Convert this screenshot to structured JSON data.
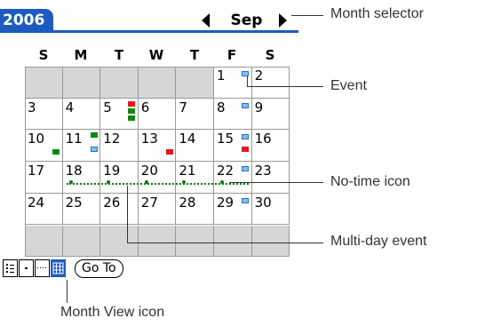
{
  "header": {
    "year": "2006",
    "month": "Sep"
  },
  "weekdays": [
    "S",
    "M",
    "T",
    "W",
    "T",
    "F",
    "S"
  ],
  "days": {
    "d1": "1",
    "d2": "2",
    "d3": "3",
    "d4": "4",
    "d5": "5",
    "d6": "6",
    "d7": "7",
    "d8": "8",
    "d9": "9",
    "d10": "10",
    "d11": "11",
    "d12": "12",
    "d13": "13",
    "d14": "14",
    "d15": "15",
    "d16": "16",
    "d17": "17",
    "d18": "18",
    "d19": "19",
    "d20": "20",
    "d21": "21",
    "d22": "22",
    "d23": "23",
    "d24": "24",
    "d25": "25",
    "d26": "26",
    "d27": "27",
    "d28": "28",
    "d29": "29",
    "d30": "30"
  },
  "toolbar": {
    "goto_label": "Go To"
  },
  "callouts": {
    "month_selector": "Month selector",
    "event": "Event",
    "no_time_icon": "No-time icon",
    "multi_day_event": "Multi-day event",
    "month_view_icon": "Month View icon"
  },
  "colors": {
    "accent": "#1d5bc0",
    "event_blue": "#7ec0ee",
    "event_green": "#0a8a0a",
    "event_red": "#e11b1b",
    "empty_cell": "#d6d6d6"
  }
}
